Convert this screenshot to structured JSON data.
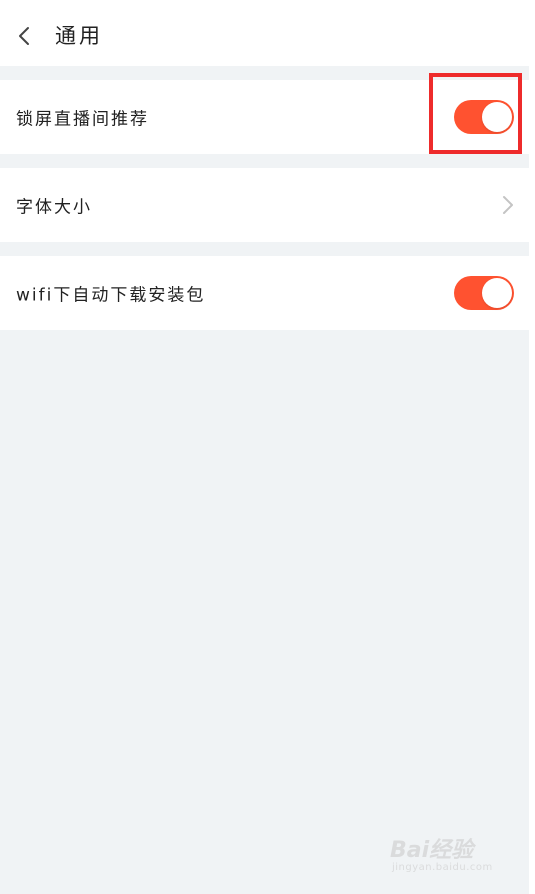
{
  "header": {
    "title": "通用"
  },
  "settings": [
    {
      "label": "锁屏直播间推荐",
      "control": "toggle",
      "on": true
    },
    {
      "label": "字体大小",
      "control": "chevron"
    },
    {
      "label": "wifi下自动下载安装包",
      "control": "toggle",
      "on": true
    }
  ],
  "colors": {
    "accent": "#ff5230",
    "background": "#f0f3f5",
    "highlight": "#ee2b2b",
    "chevron": "#c4c4c4"
  },
  "watermark": {
    "text": "Bai经验",
    "sub": "jingyan.baidu.com"
  }
}
